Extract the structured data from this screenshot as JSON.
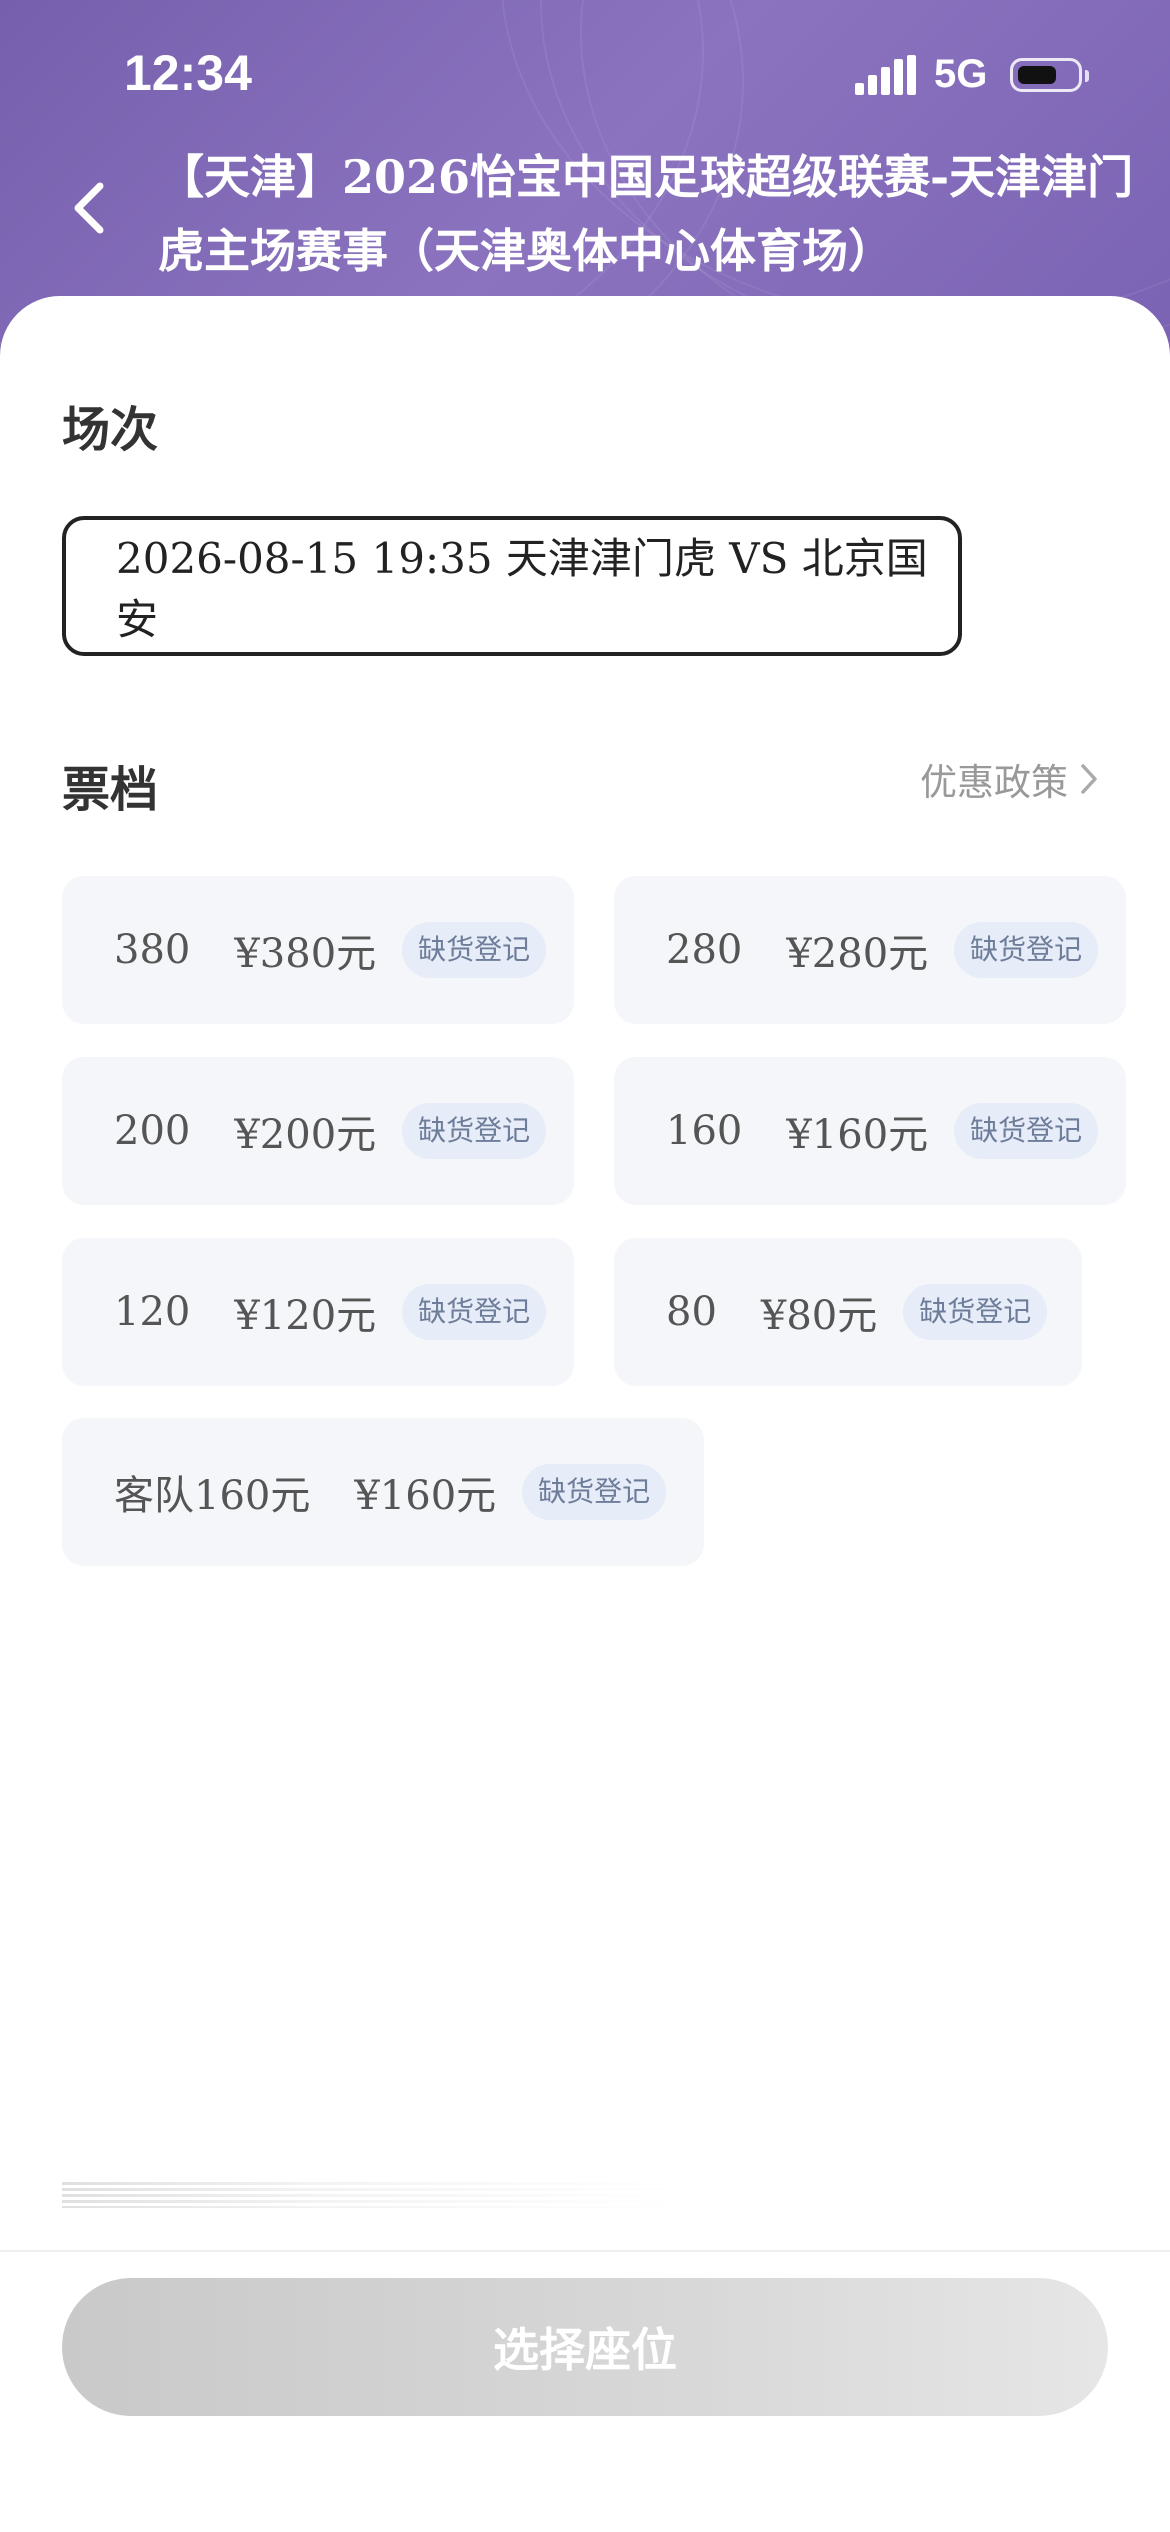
{
  "status_bar": {
    "time": "12:34",
    "network": "5G"
  },
  "header": {
    "title": "【天津】2026怡宝中国足球超级联赛-天津津门虎主场赛事（天津奥体中心体育场）"
  },
  "session": {
    "label": "场次",
    "selected": "2026-08-15 19:35 天津津门虎 VS 北京国安"
  },
  "tiers_section": {
    "label": "票档",
    "policy_link": "优惠政策",
    "items": [
      {
        "name": "380",
        "price": "¥380元",
        "badge": "缺货登记"
      },
      {
        "name": "280",
        "price": "¥280元",
        "badge": "缺货登记"
      },
      {
        "name": "200",
        "price": "¥200元",
        "badge": "缺货登记"
      },
      {
        "name": "160",
        "price": "¥160元",
        "badge": "缺货登记"
      },
      {
        "name": "120",
        "price": "¥120元",
        "badge": "缺货登记"
      },
      {
        "name": "80",
        "price": "¥80元",
        "badge": "缺货登记"
      },
      {
        "name": "客队160元",
        "price": "¥160元",
        "badge": "缺货登记"
      }
    ]
  },
  "footer": {
    "button_label": "选择座位"
  },
  "colors": {
    "header_purple": "#7f68b8",
    "tier_bg": "#f5f6fa",
    "badge_bg": "#e6ecf8",
    "button_disabled": "#d0d0d0"
  }
}
